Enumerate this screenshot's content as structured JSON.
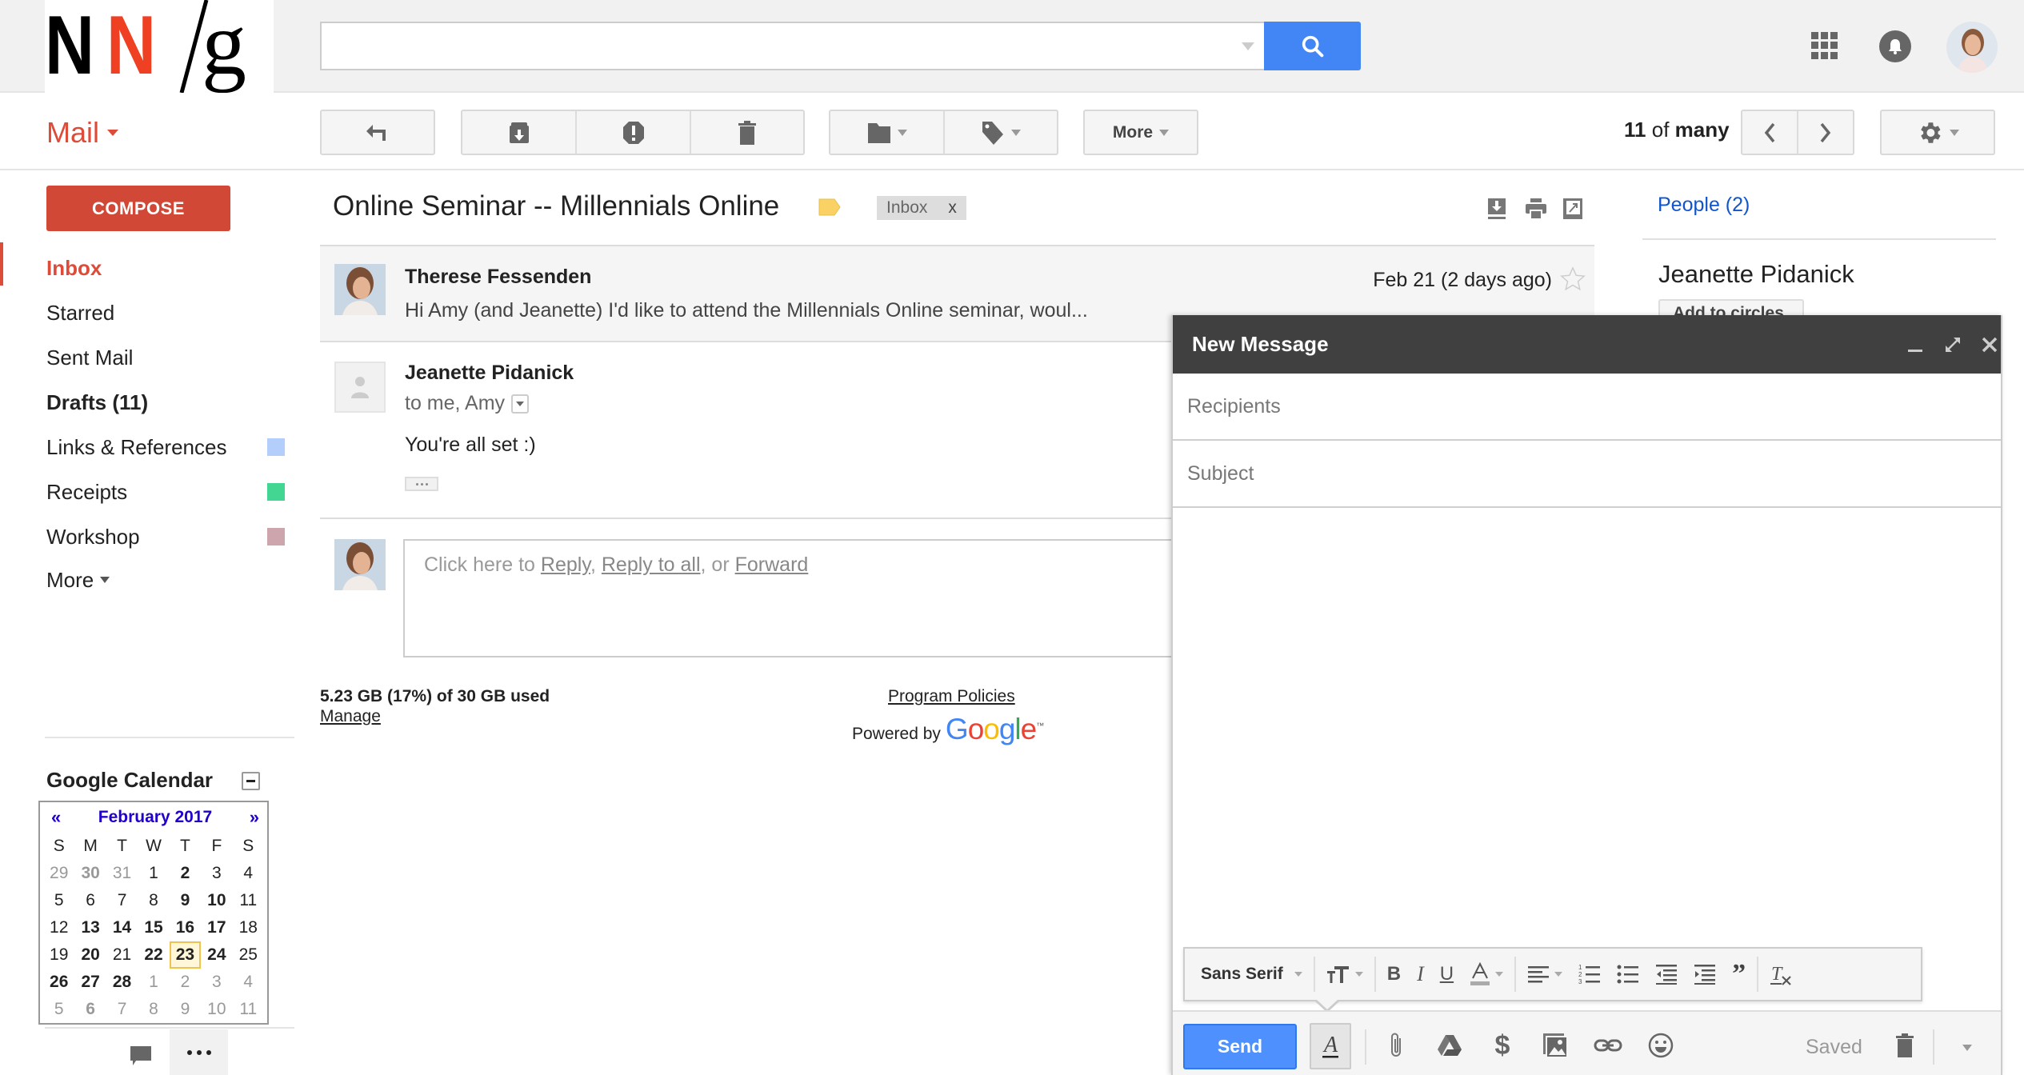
{
  "header": {
    "logo": {
      "n1": "N",
      "n2": "N",
      "slash": "/",
      "g": "g"
    },
    "search": {
      "value": "",
      "placeholder": ""
    },
    "icons": [
      "apps-grid-icon",
      "notifications-bell-icon",
      "user-avatar"
    ]
  },
  "toolbar": {
    "app_label": "Mail",
    "more_label": "More",
    "pager": {
      "current": "11",
      "of": "of",
      "total": "many"
    }
  },
  "sidebar": {
    "compose_label": "COMPOSE",
    "items": [
      {
        "label": "Inbox",
        "active": true
      },
      {
        "label": "Starred"
      },
      {
        "label": "Sent Mail"
      },
      {
        "label": "Drafts (11)",
        "bold": true
      },
      {
        "label": "Links & References",
        "color": "#b3cefb"
      },
      {
        "label": "Receipts",
        "color": "#42d692"
      },
      {
        "label": "Workshop",
        "color": "#cca6ac"
      },
      {
        "label": "More"
      }
    ]
  },
  "calendar": {
    "title": "Google Calendar",
    "month": "February 2017",
    "prev": "«",
    "next": "»",
    "weekdays": [
      "S",
      "M",
      "T",
      "W",
      "T",
      "F",
      "S"
    ],
    "weeks": [
      [
        {
          "d": "29",
          "o": 1
        },
        {
          "d": "30",
          "o": 1,
          "b": 1
        },
        {
          "d": "31",
          "o": 1
        },
        {
          "d": "1"
        },
        {
          "d": "2",
          "b": 1
        },
        {
          "d": "3"
        },
        {
          "d": "4"
        }
      ],
      [
        {
          "d": "5"
        },
        {
          "d": "6"
        },
        {
          "d": "7"
        },
        {
          "d": "8"
        },
        {
          "d": "9",
          "b": 1
        },
        {
          "d": "10",
          "b": 1
        },
        {
          "d": "11"
        }
      ],
      [
        {
          "d": "12"
        },
        {
          "d": "13",
          "b": 1
        },
        {
          "d": "14",
          "b": 1
        },
        {
          "d": "15",
          "b": 1
        },
        {
          "d": "16",
          "b": 1
        },
        {
          "d": "17",
          "b": 1
        },
        {
          "d": "18"
        }
      ],
      [
        {
          "d": "19"
        },
        {
          "d": "20",
          "b": 1
        },
        {
          "d": "21"
        },
        {
          "d": "22",
          "b": 1
        },
        {
          "d": "23",
          "b": 1,
          "today": 1
        },
        {
          "d": "24",
          "b": 1
        },
        {
          "d": "25"
        }
      ],
      [
        {
          "d": "26",
          "b": 1
        },
        {
          "d": "27",
          "b": 1
        },
        {
          "d": "28",
          "b": 1
        },
        {
          "d": "1",
          "o": 1
        },
        {
          "d": "2",
          "o": 1
        },
        {
          "d": "3",
          "o": 1
        },
        {
          "d": "4",
          "o": 1
        }
      ],
      [
        {
          "d": "5",
          "o": 1
        },
        {
          "d": "6",
          "o": 1,
          "b": 1
        },
        {
          "d": "7",
          "o": 1
        },
        {
          "d": "8",
          "o": 1
        },
        {
          "d": "9",
          "o": 1
        },
        {
          "d": "10",
          "o": 1
        },
        {
          "d": "11",
          "o": 1
        }
      ]
    ]
  },
  "thread": {
    "subject": "Online Seminar -- Millennials Online",
    "label_chip": "Inbox",
    "label_remove": "x",
    "messages": [
      {
        "sender": "Therese Fessenden",
        "date": "Feb 21 (2 days ago)",
        "snippet": "Hi Amy (and Jeanette) I'd like to attend the Millennials Online seminar, woul..."
      },
      {
        "sender": "Jeanette Pidanick",
        "to": "to me, Amy",
        "body": "You're all set :)"
      }
    ],
    "reply": {
      "prefix": "Click here to ",
      "reply": "Reply",
      "sep1": ", ",
      "reply_all": "Reply to all",
      "sep2": ", or ",
      "forward": "Forward"
    }
  },
  "footer": {
    "storage": "5.23 GB (17%) of 30 GB used",
    "manage": "Manage",
    "policies": "Program Policies",
    "powered_by": "Powered by",
    "google": "Google",
    "tm": "™"
  },
  "people": {
    "link": "People (2)",
    "name": "Jeanette Pidanick",
    "add_button": "Add to circles"
  },
  "compose": {
    "title": "New Message",
    "recipients_placeholder": "Recipients",
    "subject_placeholder": "Subject",
    "body": "",
    "font": "Sans Serif",
    "send_label": "Send",
    "status": "Saved"
  }
}
